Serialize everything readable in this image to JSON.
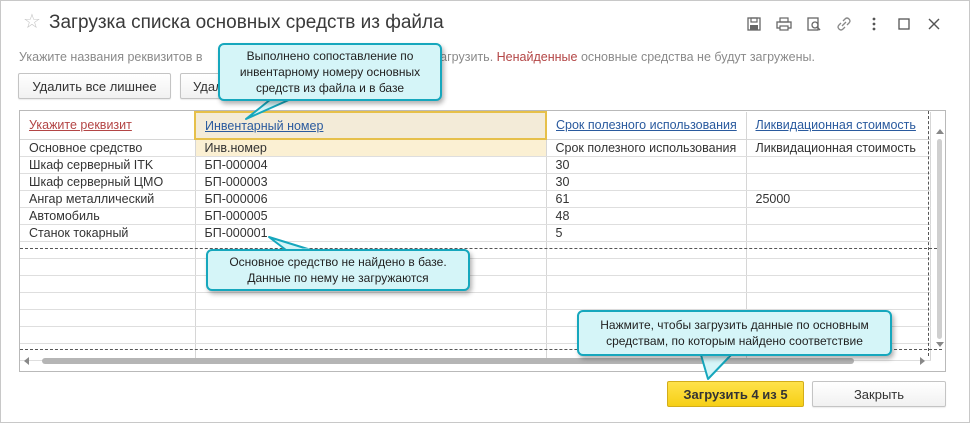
{
  "window": {
    "title": "Загрузка списка основных средств из файла",
    "star_icon": "star-icon"
  },
  "titlebar_icons": [
    "save-icon",
    "print-icon",
    "preview-icon",
    "link-icon",
    "more-icon",
    "minimize-icon",
    "maximize-icon",
    "close-icon"
  ],
  "hint": {
    "prefix": "Укажите названия реквизитов в",
    "middle": "загрузить.",
    "red_word": "Ненайденные",
    "suffix": "основные средства не будут загружены."
  },
  "toolbar": {
    "remove_all_label": "Удалить все лишнее",
    "second_label": "Удал"
  },
  "grid": {
    "header": [
      {
        "text": "Укажите реквизит",
        "style": "red"
      },
      {
        "text": "Инвентарный номер",
        "style": "blue"
      },
      {
        "text": "Срок полезного использования",
        "style": "blue"
      },
      {
        "text": "Ликвидационная стоимость",
        "style": "blue"
      }
    ],
    "subheader": [
      "Основное средство",
      "Инв.номер",
      "Срок полезного использования",
      "Ликвидационная стоимость"
    ],
    "rows": [
      {
        "name": "Шкаф серверный ITK",
        "inv": "БП-000004",
        "found": true,
        "term": "30",
        "liq": ""
      },
      {
        "name": "Шкаф серверный ЦМО",
        "inv": "БП-000003",
        "found": true,
        "term": "30",
        "liq": ""
      },
      {
        "name": "Ангар металлический",
        "inv": "БП-000006",
        "found": true,
        "term": "61",
        "liq": "25000"
      },
      {
        "name": "Автомобиль",
        "inv": "БП-000005",
        "found": true,
        "term": "48",
        "liq": ""
      },
      {
        "name": "Станок токарный",
        "inv": "БП-000001",
        "found": false,
        "term": "5",
        "liq": ""
      }
    ]
  },
  "buttons": {
    "load_label": "Загрузить 4 из 5",
    "close_label": "Закрыть"
  },
  "callouts": {
    "matched": "Выполнено сопоставление по инвентарному номеру основных средств из файла и в базе",
    "not_found": "Основное средство не найдено в базе. Данные по нему не загружаются",
    "load_hint": "Нажмите, чтобы загрузить данные по основным средствам, по которым найдено соответствие"
  },
  "colors": {
    "callout_bg": "#d5f5f8",
    "callout_border": "#16a7bd",
    "load_button": "#f6cf16",
    "not_found_red": "#b34545",
    "link_blue": "#2a5a9e"
  }
}
